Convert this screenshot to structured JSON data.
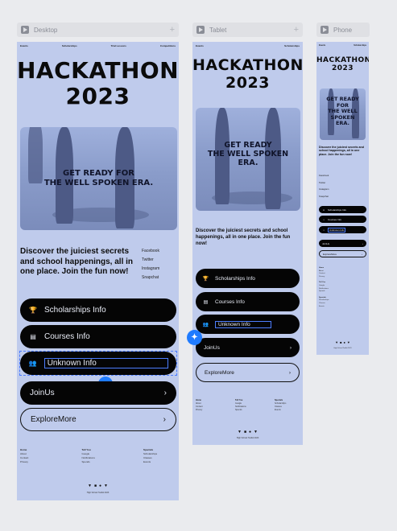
{
  "frames": {
    "desktop": "Desktop",
    "tablet": "Tablet",
    "phone": "Phone"
  },
  "nav": [
    "Events",
    "Scholarships",
    "Trial Lessons",
    "Competitions"
  ],
  "nav_short": [
    "Events",
    "Scholarships"
  ],
  "title_line1": "HACKATHON",
  "title_line2": "2023",
  "hero_line1": "GET READY FOR",
  "hero_line2": "THE WELL SPOKEN ERA.",
  "phone_hero": [
    "GET READY",
    "FOR",
    "THE WELL",
    "SPOKEN",
    "ERA."
  ],
  "intro": "Discover the juiciest secrets and school happenings, all in one place. Join the fun now!",
  "social": [
    "Facebook",
    "Twitter",
    "Instagram",
    "Snapchat"
  ],
  "buttons": {
    "scholarships": "Scholarships Info",
    "courses": "Courses Info",
    "unknown": "Unknown Info",
    "join": "JoinUs",
    "explore": "ExploreMore"
  },
  "footer": {
    "col1": {
      "title": "Home",
      "items": [
        "About",
        "Contact",
        "Privacy"
      ]
    },
    "col2": {
      "title": "Tell You",
      "items": [
        "Google",
        "Notifications",
        "Spends"
      ]
    },
    "col3": {
      "title": "Specials",
      "items": [
        "Scholarships",
        "Classes",
        "Events"
      ]
    }
  },
  "icon_names": [
    "bird-icon",
    "camera-icon",
    "play-icon",
    "pin-icon"
  ],
  "copyright": "High School Toolkit 2023",
  "colors": {
    "page": "#bfcbec",
    "pill": "#050505",
    "accent": "#1f7bff"
  }
}
